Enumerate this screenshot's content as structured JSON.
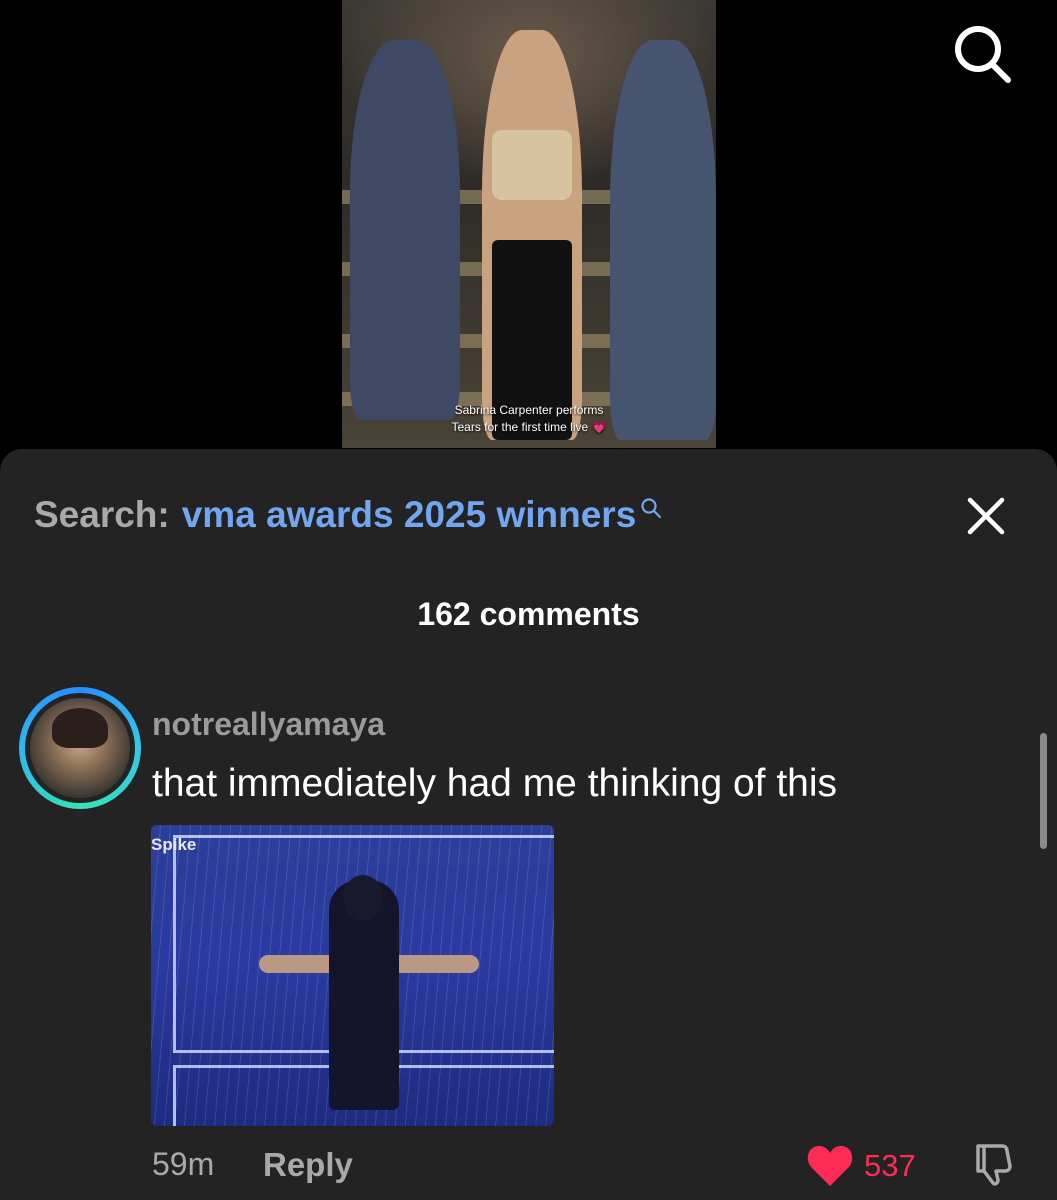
{
  "video": {
    "caption_line1": "Sabrina Carpenter performs",
    "caption_line2": "Tears for the first time live",
    "caption_emoji": "💗"
  },
  "header": {
    "search_icon": "search-icon"
  },
  "search_bar": {
    "label": "Search:",
    "query": "vma awards 2025 winners",
    "query_icon": "search-icon",
    "close_icon": "close-icon"
  },
  "comments": {
    "count_label": "162 comments",
    "items": [
      {
        "username": "notreallyamaya",
        "text": "that immediately had me thinking of this",
        "image_logo": "Spike",
        "time": "59m",
        "reply_label": "Reply",
        "likes": "537",
        "like_icon": "heart-icon",
        "dislike_icon": "thumbs-down-icon"
      }
    ]
  },
  "colors": {
    "accent_query": "#72a6f0",
    "like_red": "#fe2c55",
    "sheet_bg": "#232323"
  }
}
